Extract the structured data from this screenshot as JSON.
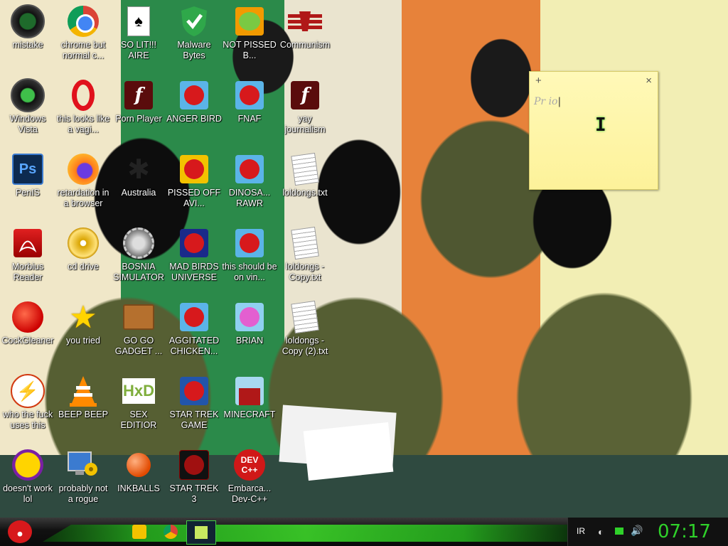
{
  "desktop": {
    "icons": [
      {
        "label": "mistake"
      },
      {
        "label": "chrome but normal c..."
      },
      {
        "label": "SO LIT!!! AIRE"
      },
      {
        "label": "Malware Bytes"
      },
      {
        "label": "NOT PISSED B..."
      },
      {
        "label": "Communism"
      },
      {
        "label": "Windows Vista"
      },
      {
        "label": "this looks like a vagi..."
      },
      {
        "label": "Porn Player"
      },
      {
        "label": "ANGER BIRD"
      },
      {
        "label": "FNAF"
      },
      {
        "label": "yay journalism"
      },
      {
        "label": "PenIS"
      },
      {
        "label": "retardation in a browser"
      },
      {
        "label": "Australia"
      },
      {
        "label": "PISSED OFF AVI..."
      },
      {
        "label": "DINOSA... RAWR"
      },
      {
        "label": "loldongs.txt"
      },
      {
        "label": "Morbius Reader"
      },
      {
        "label": "cd drive"
      },
      {
        "label": "BOSNIA SIMULATOR"
      },
      {
        "label": "MAD BIRDS UNIVERSE"
      },
      {
        "label": "this should be on vin..."
      },
      {
        "label": "loldongs - Copy.txt"
      },
      {
        "label": "CockGleaner"
      },
      {
        "label": "you tried"
      },
      {
        "label": "GO GO GADGET ..."
      },
      {
        "label": "AGGITATED CHICKEN..."
      },
      {
        "label": "BRIAN"
      },
      {
        "label": "loldongs - Copy (2).txt"
      },
      {
        "label": "who the fuck uses this"
      },
      {
        "label": "BEEP BEEP"
      },
      {
        "label": "SEX EDITIOR"
      },
      {
        "label": "STAR TREK GAME"
      },
      {
        "label": "MINECRAFT"
      },
      {
        "label": "doesn't work lol"
      },
      {
        "label": "probably not a rogue"
      },
      {
        "label": "INKBALLS"
      },
      {
        "label": "STAR TREK 3"
      },
      {
        "label": "Embarca... Dev-C++"
      }
    ]
  },
  "sticky": {
    "add": "+",
    "close": "×",
    "text": "Pr io",
    "caret": "I"
  },
  "taskbar": {
    "lang": "IR",
    "clock": "07:17"
  },
  "colors": {
    "accent": "#2fd12a",
    "sticky": "#fdf29a"
  }
}
